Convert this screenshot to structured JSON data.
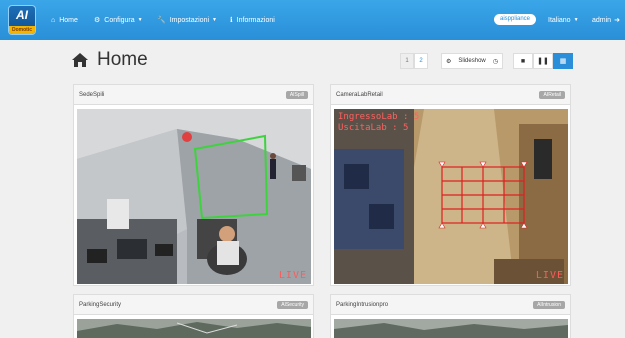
{
  "nav": {
    "logo_main": "AI",
    "logo_sub": "Domotic",
    "items": [
      {
        "label": "Home",
        "icon": "home-icon",
        "caret": false
      },
      {
        "label": "Configura",
        "icon": "gear-icon",
        "caret": true
      },
      {
        "label": "Impostazioni",
        "icon": "wrench-icon",
        "caret": true
      },
      {
        "label": "Informazioni",
        "icon": "info-icon",
        "caret": false
      }
    ],
    "user_pill": "aisppliance",
    "language": "Italiano",
    "user": "admin"
  },
  "page": {
    "title": "Home",
    "pages": [
      "1",
      "2"
    ],
    "slideshow_label": "Slideshow"
  },
  "colors": {
    "navbar": "#2a8fd8",
    "live": "#ff5a5a"
  },
  "cameras": [
    {
      "name": "SedeSpili",
      "badge": "AISpill",
      "live": "LIVE",
      "overlay": []
    },
    {
      "name": "CameraLabRetail",
      "badge": "AIRetail",
      "live": "LIVE",
      "overlay": [
        "IngressoLab : 5",
        "UscitaLab : 5"
      ]
    },
    {
      "name": "ParkingSecurity",
      "badge": "AISecurity",
      "live": "",
      "overlay": []
    },
    {
      "name": "ParkingIntrusionpro",
      "badge": "AIIntrusion",
      "live": "",
      "overlay": []
    }
  ]
}
